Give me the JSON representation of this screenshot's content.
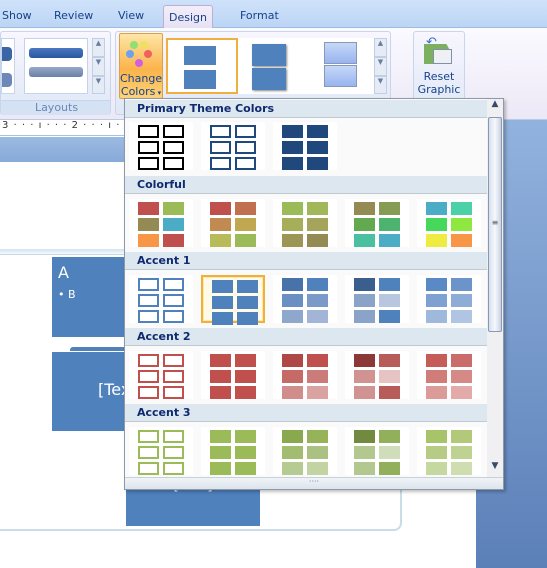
{
  "tabs": [
    {
      "label": "Show"
    },
    {
      "label": "Review"
    },
    {
      "label": "View"
    },
    {
      "label": "Design"
    },
    {
      "label": "Format"
    }
  ],
  "ribbon": {
    "layouts_group_label": "Layouts",
    "change_colors_line1": "Change",
    "change_colors_line2": "Colors",
    "reset_line1": "Reset",
    "reset_line2": "Graphic"
  },
  "ruler": "3 · · · ı · · · 2 · · · ı · ·",
  "document": {
    "shape_a_title": "A",
    "shape_a_bullet": "• B",
    "shape_text": "[Text]",
    "shape_text2": "[Text]"
  },
  "dropdown": {
    "sections": [
      {
        "label": "Primary Theme Colors",
        "items": [
          {
            "style": "outline",
            "colors": [
              "#000000",
              "#000000",
              "#000000",
              "#000000",
              "#000000",
              "#000000"
            ]
          },
          {
            "style": "outline",
            "colors": [
              "#1f497d",
              "#1f497d",
              "#1f497d",
              "#1f497d",
              "#1f497d",
              "#1f497d"
            ]
          },
          {
            "style": "fill",
            "colors": [
              "#1f497d",
              "#1f497d",
              "#1f497d",
              "#1f497d",
              "#1f497d",
              "#1f497d"
            ]
          }
        ]
      },
      {
        "label": "Colorful",
        "items": [
          {
            "style": "fill",
            "colors": [
              "#c0504d",
              "#9bbb59",
              "#948a54",
              "#4bacc6",
              "#f79646",
              "#c0504d"
            ]
          },
          {
            "style": "fill",
            "colors": [
              "#c0504d",
              "#c0704f",
              "#c08a50",
              "#c0a850",
              "#b8bb59",
              "#9bbb59"
            ]
          },
          {
            "style": "fill",
            "colors": [
              "#9bbb59",
              "#a1b75a",
              "#a6ae5a",
              "#a4a45a",
              "#9c9655",
              "#948a54"
            ]
          },
          {
            "style": "fill",
            "colors": [
              "#948a54",
              "#889b54",
              "#62a94f",
              "#4cb46e",
              "#4bc0a0",
              "#4bacc6"
            ]
          },
          {
            "style": "fill",
            "colors": [
              "#4bacc6",
              "#4bd0a8",
              "#46d85a",
              "#8ee840",
              "#eeec40",
              "#f79646"
            ]
          }
        ]
      },
      {
        "label": "Accent 1",
        "items": [
          {
            "style": "outline",
            "colors": [
              "#4f81bd",
              "#4f81bd",
              "#4f81bd",
              "#4f81bd",
              "#4f81bd",
              "#4f81bd"
            ]
          },
          {
            "style": "fill",
            "selected": true,
            "colors": [
              "#4f81bd",
              "#4f81bd",
              "#4f81bd",
              "#4f81bd",
              "#4f81bd",
              "#4f81bd"
            ]
          },
          {
            "style": "fill",
            "colors": [
              "#4772aa",
              "#4f81bd",
              "#6a8fc2",
              "#7b9ac8",
              "#8ea8cd",
              "#a3b5d7"
            ]
          },
          {
            "style": "fill",
            "colors": [
              "#3a5f8f",
              "#4f81bd",
              "#8aa3c9",
              "#b9c6df",
              "#8aa3c9",
              "#4f81bd"
            ]
          },
          {
            "style": "fill",
            "colors": [
              "#5a8ac6",
              "#6b94cb",
              "#7ea1d1",
              "#8eadd6",
              "#9eb9dc",
              "#b0c5e3"
            ]
          }
        ]
      },
      {
        "label": "Accent 2",
        "items": [
          {
            "style": "outline",
            "colors": [
              "#c0504d",
              "#c0504d",
              "#c0504d",
              "#c0504d",
              "#c0504d",
              "#c0504d"
            ]
          },
          {
            "style": "fill",
            "colors": [
              "#c0504d",
              "#c0504d",
              "#c0504d",
              "#c0504d",
              "#c0504d",
              "#c0504d"
            ]
          },
          {
            "style": "fill",
            "colors": [
              "#ae4745",
              "#c0504d",
              "#c66a67",
              "#cb7b79",
              "#d08d8b",
              "#d8a3a1"
            ]
          },
          {
            "style": "fill",
            "colors": [
              "#8c3836",
              "#b85c59",
              "#d19391",
              "#e5c4c3",
              "#d19391",
              "#b85c59"
            ]
          },
          {
            "style": "fill",
            "colors": [
              "#c55c58",
              "#ca6c69",
              "#d07c79",
              "#d68a88",
              "#db9b99",
              "#e2aaa8"
            ]
          }
        ]
      },
      {
        "label": "Accent 3",
        "items": [
          {
            "style": "outline",
            "colors": [
              "#9bbb59",
              "#9bbb59",
              "#9bbb59",
              "#9bbb59",
              "#9bbb59",
              "#9bbb59"
            ]
          },
          {
            "style": "fill",
            "colors": [
              "#9bbb59",
              "#9bbb59",
              "#9bbb59",
              "#9bbb59",
              "#9bbb59",
              "#9bbb59"
            ]
          },
          {
            "style": "fill",
            "colors": [
              "#8aa94e",
              "#97b35a",
              "#a3bd70",
              "#abc181",
              "#b5cb91",
              "#c3d3a2"
            ]
          },
          {
            "style": "fill",
            "colors": [
              "#728a40",
              "#92b05c",
              "#b2c88e",
              "#d0ddbb",
              "#b2c88e",
              "#92b05c"
            ]
          },
          {
            "style": "fill",
            "colors": [
              "#a8c46a",
              "#b1c978",
              "#b6cc84",
              "#bed291",
              "#c5d89f",
              "#cfddb0"
            ]
          }
        ]
      }
    ]
  }
}
